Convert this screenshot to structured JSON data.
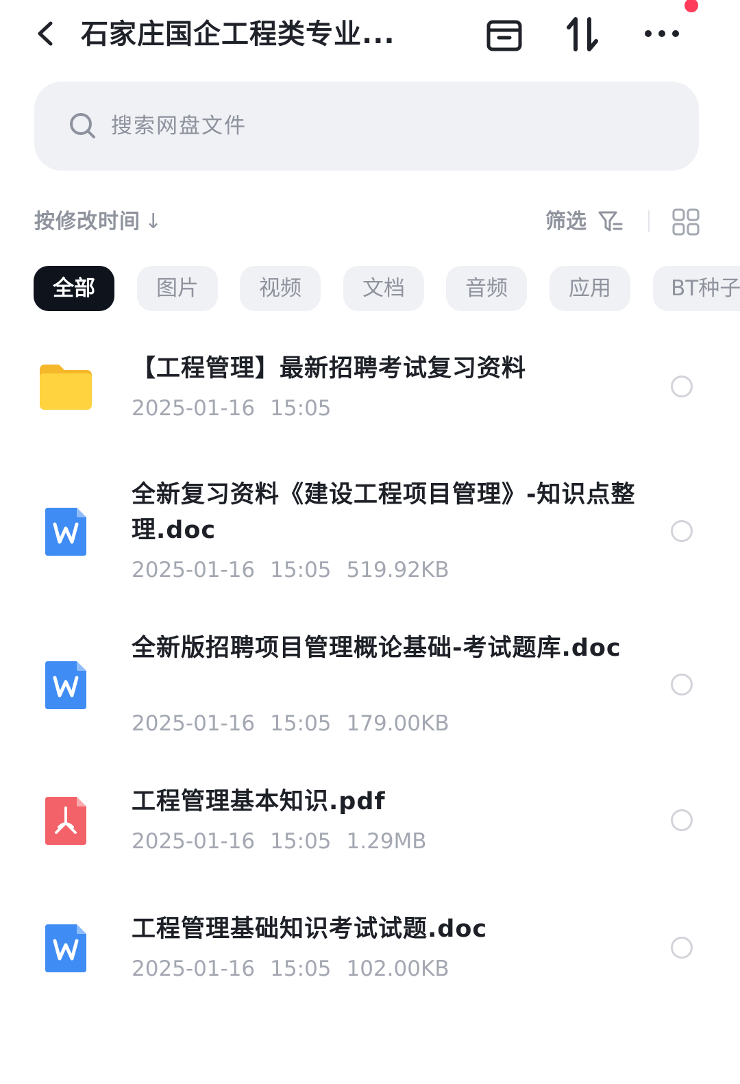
{
  "header": {
    "title": "石家庄国企工程类专业...",
    "back_icon": "chevron-left-icon",
    "archive_icon": "archive-box-icon",
    "transfer_icon": "up-down-arrows-icon",
    "more_icon": "more-dots-icon"
  },
  "search": {
    "placeholder": "搜索网盘文件"
  },
  "toolbar": {
    "sort_label": "按修改时间",
    "sort_arrow": "↓",
    "filter_label": "筛选"
  },
  "chips": [
    {
      "label": "全部",
      "active": true
    },
    {
      "label": "图片",
      "active": false
    },
    {
      "label": "视频",
      "active": false
    },
    {
      "label": "文档",
      "active": false
    },
    {
      "label": "音频",
      "active": false
    },
    {
      "label": "应用",
      "active": false
    },
    {
      "label": "BT种子",
      "active": false
    }
  ],
  "files": [
    {
      "name": "【工程管理】最新招聘考试复习资料",
      "date": "2025-01-16",
      "time": "15:05",
      "size": "",
      "type": "folder"
    },
    {
      "name": "全新复习资料《建设工程项目管理》-知识点整理.doc",
      "date": "2025-01-16",
      "time": "15:05",
      "size": "519.92KB",
      "type": "word"
    },
    {
      "name": "全新版招聘项目管理概论基础-考试题库.doc",
      "date": "2025-01-16",
      "time": "15:05",
      "size": "179.00KB",
      "type": "word"
    },
    {
      "name": "工程管理基本知识.pdf",
      "date": "2025-01-16",
      "time": "15:05",
      "size": "1.29MB",
      "type": "pdf"
    },
    {
      "name": "工程管理基础知识考试试题.doc",
      "date": "2025-01-16",
      "time": "15:05",
      "size": "102.00KB",
      "type": "word"
    }
  ],
  "colors": {
    "folder": "#ffc933",
    "word": "#3f8cf5",
    "pdf": "#f26268",
    "active_chip": "#0e131c",
    "notification_dot": "#ff3b5c"
  }
}
